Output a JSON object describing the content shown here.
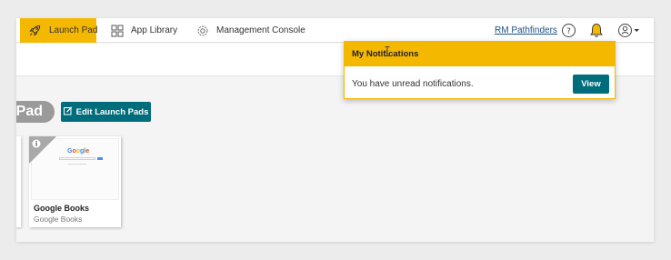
{
  "nav": {
    "items": [
      {
        "label": "Launch Pad",
        "icon": "rocket-icon",
        "active": true
      },
      {
        "label": "App Library",
        "icon": "grid-icon",
        "active": false
      },
      {
        "label": "Management Console",
        "icon": "gear-icon",
        "active": false
      }
    ],
    "user_link": "RM Pathfinders",
    "help_icon": "help-icon",
    "bell_icon": "bell-icon",
    "account_icon": "account-icon"
  },
  "page": {
    "pad_label": "Pad",
    "edit_button": "Edit Launch Pads"
  },
  "tiles": [
    {
      "title": "Google Books",
      "subtitle": "Google Books",
      "thumb_logo": "Google",
      "info_icon": "info-icon"
    }
  ],
  "notifications": {
    "title": "My Notifications",
    "message": "You have unread notifications.",
    "view_label": "View"
  },
  "colors": {
    "accent_yellow": "#f5b800",
    "teal": "#006d7c",
    "link_blue": "#1a4f86"
  }
}
